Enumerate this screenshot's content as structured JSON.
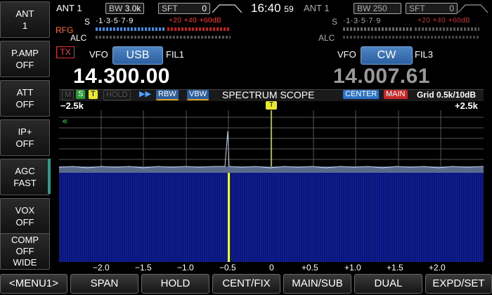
{
  "left_panel": [
    {
      "name": "ant",
      "line1": "ANT",
      "line2": "1"
    },
    {
      "name": "p-amp",
      "line1": "P.AMP",
      "line2": "OFF"
    },
    {
      "name": "att",
      "line1": "ATT",
      "line2": "OFF"
    },
    {
      "name": "ip-plus",
      "line1": "IP+",
      "line2": "OFF"
    },
    {
      "name": "agc",
      "line1": "AGC",
      "line2": "FAST"
    },
    {
      "name": "vox",
      "line1": "VOX",
      "line2": "OFF"
    },
    {
      "name": "comp",
      "line1": "COMP",
      "line2": "OFF",
      "line3": "WIDE"
    }
  ],
  "main_rx": {
    "ant": "ANT 1",
    "bw_label": "BW",
    "bw_value": "3.0k",
    "sft_label": "SFT",
    "sft_value": "0",
    "s_label": "S",
    "s_scale": "·1·3·5·7·9",
    "s_plus": "+20 +40 +60dB",
    "rfg": "RFG",
    "alc": "ALC",
    "tx": "TX",
    "vfo": "VFO",
    "mode": "USB",
    "fil": "FIL1",
    "frequency": "14.300.00"
  },
  "clock": {
    "time": "16:40",
    "seconds": "59"
  },
  "sub_rx": {
    "ant": "ANT 1",
    "bw_label": "BW",
    "bw_value": "250",
    "sft_label": "SFT",
    "sft_value": "0",
    "s_label": "S",
    "s_scale": "·1·3·5·7·9",
    "s_plus": "+20 +40 +60dB",
    "alc": "ALC",
    "vfo": "VFO",
    "mode": "CW",
    "fil": "FIL3",
    "frequency": "14.007.61"
  },
  "scope": {
    "title": "SPECTRUM SCOPE",
    "m": "M",
    "s": "S",
    "t": "T",
    "hold": "HOLD",
    "arrows": "▶▶",
    "rbw": "RBW",
    "vbw": "VBW",
    "center": "CENTER",
    "main": "MAIN",
    "grid": "Grid 0.5k/10dB",
    "left_edge": "−2.5k",
    "right_edge": "+2.5k",
    "marker": "T",
    "back": "«",
    "x_ticks": [
      "−2.0",
      "−1.5",
      "−1.0",
      "−0.5",
      "0",
      "+0.5",
      "+1.0",
      "+1.5",
      "+2.0"
    ]
  },
  "bottom_buttons": [
    "<MENU1>",
    "SPAN",
    "HOLD",
    "CENT/FIX",
    "MAIN/SUB",
    "DUAL",
    "EXPD/SET"
  ],
  "colors": {
    "waterfall": "#0d1a8a",
    "signal": "#e8ff4a",
    "button_blue": "#3a6fb0"
  }
}
